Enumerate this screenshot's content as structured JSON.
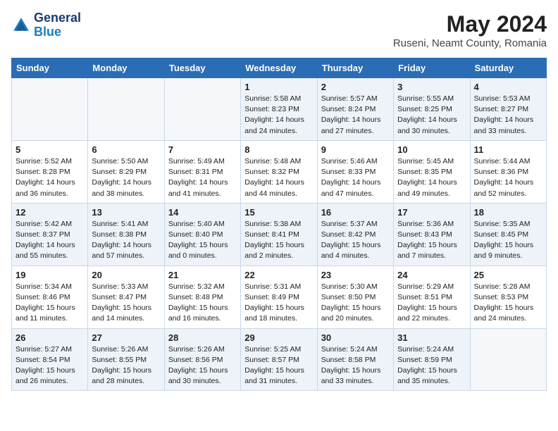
{
  "header": {
    "logo_line1": "General",
    "logo_line2": "Blue",
    "month_year": "May 2024",
    "location": "Ruseni, Neamt County, Romania"
  },
  "weekdays": [
    "Sunday",
    "Monday",
    "Tuesday",
    "Wednesday",
    "Thursday",
    "Friday",
    "Saturday"
  ],
  "rows": [
    [
      {
        "day": "",
        "data": ""
      },
      {
        "day": "",
        "data": ""
      },
      {
        "day": "",
        "data": ""
      },
      {
        "day": "1",
        "data": "Sunrise: 5:58 AM\nSunset: 8:23 PM\nDaylight: 14 hours and 24 minutes."
      },
      {
        "day": "2",
        "data": "Sunrise: 5:57 AM\nSunset: 8:24 PM\nDaylight: 14 hours and 27 minutes."
      },
      {
        "day": "3",
        "data": "Sunrise: 5:55 AM\nSunset: 8:25 PM\nDaylight: 14 hours and 30 minutes."
      },
      {
        "day": "4",
        "data": "Sunrise: 5:53 AM\nSunset: 8:27 PM\nDaylight: 14 hours and 33 minutes."
      }
    ],
    [
      {
        "day": "5",
        "data": "Sunrise: 5:52 AM\nSunset: 8:28 PM\nDaylight: 14 hours and 36 minutes."
      },
      {
        "day": "6",
        "data": "Sunrise: 5:50 AM\nSunset: 8:29 PM\nDaylight: 14 hours and 38 minutes."
      },
      {
        "day": "7",
        "data": "Sunrise: 5:49 AM\nSunset: 8:31 PM\nDaylight: 14 hours and 41 minutes."
      },
      {
        "day": "8",
        "data": "Sunrise: 5:48 AM\nSunset: 8:32 PM\nDaylight: 14 hours and 44 minutes."
      },
      {
        "day": "9",
        "data": "Sunrise: 5:46 AM\nSunset: 8:33 PM\nDaylight: 14 hours and 47 minutes."
      },
      {
        "day": "10",
        "data": "Sunrise: 5:45 AM\nSunset: 8:35 PM\nDaylight: 14 hours and 49 minutes."
      },
      {
        "day": "11",
        "data": "Sunrise: 5:44 AM\nSunset: 8:36 PM\nDaylight: 14 hours and 52 minutes."
      }
    ],
    [
      {
        "day": "12",
        "data": "Sunrise: 5:42 AM\nSunset: 8:37 PM\nDaylight: 14 hours and 55 minutes."
      },
      {
        "day": "13",
        "data": "Sunrise: 5:41 AM\nSunset: 8:38 PM\nDaylight: 14 hours and 57 minutes."
      },
      {
        "day": "14",
        "data": "Sunrise: 5:40 AM\nSunset: 8:40 PM\nDaylight: 15 hours and 0 minutes."
      },
      {
        "day": "15",
        "data": "Sunrise: 5:38 AM\nSunset: 8:41 PM\nDaylight: 15 hours and 2 minutes."
      },
      {
        "day": "16",
        "data": "Sunrise: 5:37 AM\nSunset: 8:42 PM\nDaylight: 15 hours and 4 minutes."
      },
      {
        "day": "17",
        "data": "Sunrise: 5:36 AM\nSunset: 8:43 PM\nDaylight: 15 hours and 7 minutes."
      },
      {
        "day": "18",
        "data": "Sunrise: 5:35 AM\nSunset: 8:45 PM\nDaylight: 15 hours and 9 minutes."
      }
    ],
    [
      {
        "day": "19",
        "data": "Sunrise: 5:34 AM\nSunset: 8:46 PM\nDaylight: 15 hours and 11 minutes."
      },
      {
        "day": "20",
        "data": "Sunrise: 5:33 AM\nSunset: 8:47 PM\nDaylight: 15 hours and 14 minutes."
      },
      {
        "day": "21",
        "data": "Sunrise: 5:32 AM\nSunset: 8:48 PM\nDaylight: 15 hours and 16 minutes."
      },
      {
        "day": "22",
        "data": "Sunrise: 5:31 AM\nSunset: 8:49 PM\nDaylight: 15 hours and 18 minutes."
      },
      {
        "day": "23",
        "data": "Sunrise: 5:30 AM\nSunset: 8:50 PM\nDaylight: 15 hours and 20 minutes."
      },
      {
        "day": "24",
        "data": "Sunrise: 5:29 AM\nSunset: 8:51 PM\nDaylight: 15 hours and 22 minutes."
      },
      {
        "day": "25",
        "data": "Sunrise: 5:28 AM\nSunset: 8:53 PM\nDaylight: 15 hours and 24 minutes."
      }
    ],
    [
      {
        "day": "26",
        "data": "Sunrise: 5:27 AM\nSunset: 8:54 PM\nDaylight: 15 hours and 26 minutes."
      },
      {
        "day": "27",
        "data": "Sunrise: 5:26 AM\nSunset: 8:55 PM\nDaylight: 15 hours and 28 minutes."
      },
      {
        "day": "28",
        "data": "Sunrise: 5:26 AM\nSunset: 8:56 PM\nDaylight: 15 hours and 30 minutes."
      },
      {
        "day": "29",
        "data": "Sunrise: 5:25 AM\nSunset: 8:57 PM\nDaylight: 15 hours and 31 minutes."
      },
      {
        "day": "30",
        "data": "Sunrise: 5:24 AM\nSunset: 8:58 PM\nDaylight: 15 hours and 33 minutes."
      },
      {
        "day": "31",
        "data": "Sunrise: 5:24 AM\nSunset: 8:59 PM\nDaylight: 15 hours and 35 minutes."
      },
      {
        "day": "",
        "data": ""
      }
    ]
  ]
}
